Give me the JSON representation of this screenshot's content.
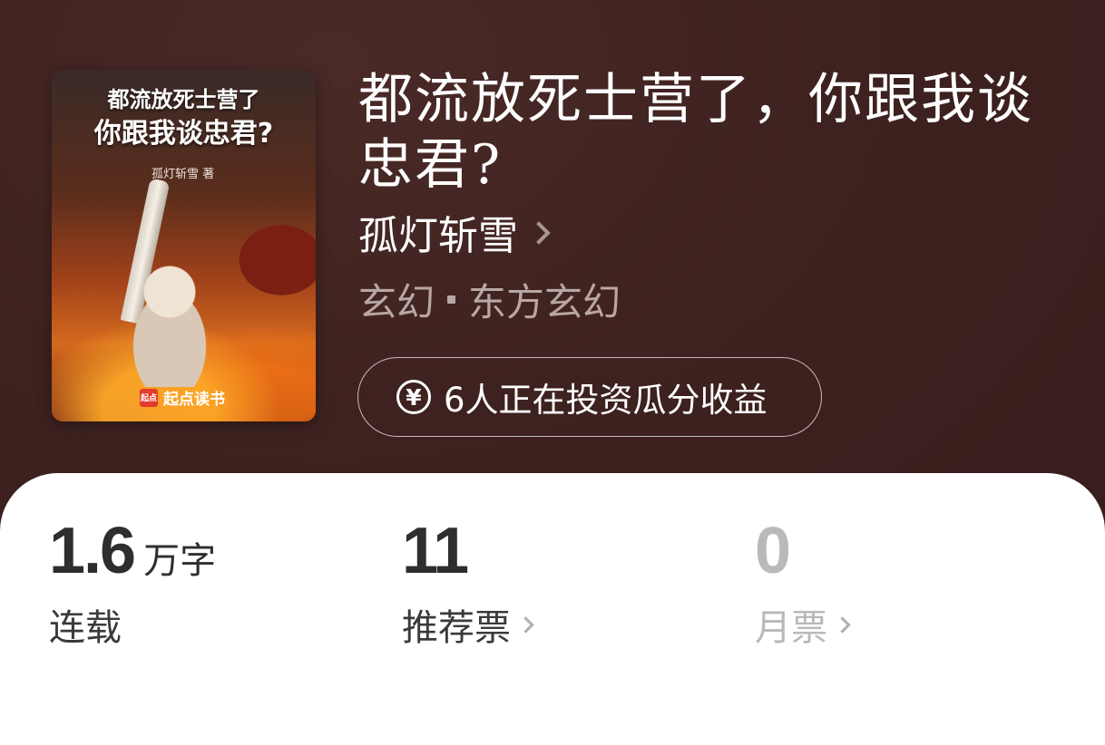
{
  "book": {
    "cover": {
      "title_line1": "都流放死士营了",
      "title_line2": "你跟我谈忠君?",
      "author": "孤灯斩雪 著",
      "publisher_badge": "起点",
      "publisher": "起点读书"
    },
    "title": "都流放死士营了，你跟我谈忠君?",
    "author": "孤灯斩雪",
    "genre": "玄幻",
    "subgenre": "东方玄幻",
    "invest_text": "6人正在投资瓜分收益",
    "invest_icon": "¥"
  },
  "stats": [
    {
      "value": "1.6",
      "unit": "万字",
      "label": "连载"
    },
    {
      "value": "11",
      "unit": "",
      "label": "推荐票"
    },
    {
      "value": "0",
      "unit": "",
      "label": "月票"
    }
  ],
  "colors": {
    "header_bg": "#3e2220",
    "card_bg": "#ffffff",
    "muted_stat": "#b9b9b9"
  }
}
